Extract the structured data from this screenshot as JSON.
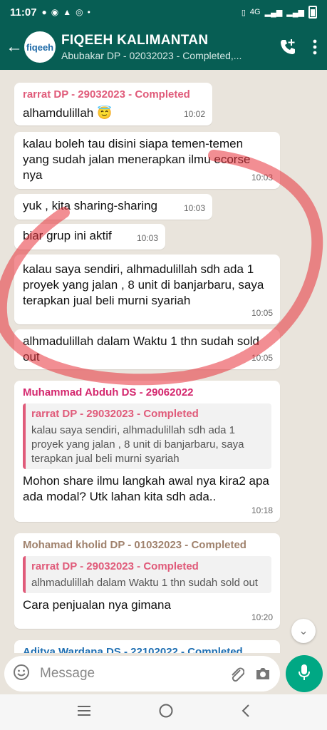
{
  "status_bar": {
    "time": "11:07",
    "network": "4G"
  },
  "header": {
    "avatar_text": "fiqeeh",
    "group_name": "FIQEEH KALIMANTAN",
    "subtitle": "Abubakar DP - 02032023 - Completed,..."
  },
  "messages": [
    {
      "sender": "rarrat DP - 29032023 - Completed",
      "sender_color": "#e05b7a",
      "text": "alhamdulillah 😇",
      "time": "10:02"
    },
    {
      "text": "kalau boleh tau disini siapa temen-temen yang sudah jalan menerapkan ilmu ecorse nya",
      "time": "10:03"
    },
    {
      "text": "yuk , kita sharing-sharing",
      "time": "10:03"
    },
    {
      "text": "biar grup ini aktif",
      "time": "10:03"
    },
    {
      "text": "kalau saya sendiri, alhmadulillah sdh ada 1 proyek yang jalan , 8 unit di banjarbaru, saya terapkan jual beli murni syariah",
      "time": "10:05"
    },
    {
      "text": "alhmadulillah dalam Waktu 1 thn sudah sold out",
      "time": "10:05"
    },
    {
      "sender": "Muhammad Abduh DS - 29062022",
      "sender_color": "#d4286e",
      "quote_sender": "rarrat DP - 29032023 - Completed",
      "quote_text": "kalau saya sendiri, alhmadulillah sdh ada 1 proyek yang jalan , 8 unit di banjarbaru, saya terapkan jual beli murni syariah",
      "text": "Mohon share ilmu langkah awal nya kira2 apa ada modal? Utk lahan kita sdh ada..",
      "time": "10:18"
    },
    {
      "sender": "Mohamad kholid DP - 01032023 - Completed",
      "sender_color": "#a0826d",
      "quote_sender": "rarrat DP - 29032023 - Completed",
      "quote_text": "alhmadulillah dalam Waktu 1 thn sudah sold out",
      "text": "Cara penjualan nya gimana",
      "time": "10:20"
    },
    {
      "sender": "Aditya Wardana DS - 22102022 - Completed",
      "sender_color": "#1f6fb2"
    }
  ],
  "input": {
    "placeholder": "Message"
  },
  "colors": {
    "header": "#075e54",
    "accent": "#00a884",
    "annotation": "#e8313a"
  }
}
